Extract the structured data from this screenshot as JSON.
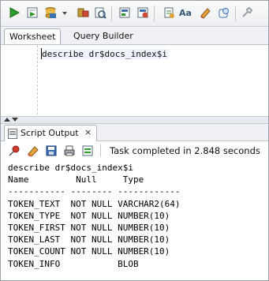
{
  "toolbar": {
    "icons": [
      "run-statement-icon",
      "run-script-icon",
      "commit-icon",
      "rollback-icon",
      "autotrace-icon",
      "explain-plan-icon",
      "sql-tuning-icon",
      "clear-icon",
      "sql-history-icon",
      "uppercase-icon",
      "format-icon",
      "find-icon",
      "unshared-sql-icon"
    ]
  },
  "tabs": {
    "worksheet": "Worksheet",
    "query_builder": "Query Builder"
  },
  "editor": {
    "text": "describe dr$docs_index$i"
  },
  "output_panel": {
    "tab_label": "Script Output",
    "close_glyph": "×",
    "status": "Task completed in 2.848 seconds",
    "lines": [
      "describe dr$docs_index$i",
      "Name         Null     Type",
      "----------- -------- ------------",
      "TOKEN_TEXT  NOT NULL VARCHAR2(64)",
      "TOKEN_TYPE  NOT NULL NUMBER(10)",
      "TOKEN_FIRST NOT NULL NUMBER(10)",
      "TOKEN_LAST  NOT NULL NUMBER(10)",
      "TOKEN_COUNT NOT NULL NUMBER(10)",
      "TOKEN_INFO           BLOB"
    ]
  },
  "colors": {
    "run_green": "#2e9a2e",
    "status_background": "#eef0f3",
    "editor_highlight": "#eef2fb"
  }
}
